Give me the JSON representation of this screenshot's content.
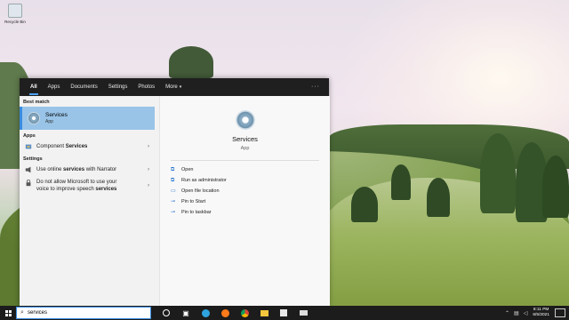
{
  "desktop": {
    "icon_label": "Recycle Bin"
  },
  "start_menu": {
    "tabs": [
      {
        "label": "All",
        "active": true
      },
      {
        "label": "Apps"
      },
      {
        "label": "Documents"
      },
      {
        "label": "Settings"
      },
      {
        "label": "Photos"
      },
      {
        "label": "More"
      }
    ],
    "more_caret": "▾",
    "overflow": "···",
    "best_match": {
      "heading": "Best match",
      "title": "Services",
      "subtitle": "App"
    },
    "apps": {
      "heading": "Apps",
      "items": [
        {
          "prefix": "Component ",
          "bold": "Services",
          "suffix": ""
        }
      ]
    },
    "settings": {
      "heading": "Settings",
      "items": [
        {
          "prefix": "Use online ",
          "bold": "services",
          "suffix": " with Narrator"
        },
        {
          "line1": "Do not allow Microsoft to use your",
          "line2_prefix": "voice to improve speech ",
          "line2_bold": "services"
        }
      ]
    },
    "preview": {
      "title": "Services",
      "subtitle": "App",
      "actions": [
        {
          "icon": "open-icon",
          "label": "Open"
        },
        {
          "icon": "run-as-admin-icon",
          "label": "Run as administrator"
        },
        {
          "icon": "folder-icon",
          "label": "Open file location"
        },
        {
          "icon": "pin-icon",
          "label": "Pin to Start"
        },
        {
          "icon": "pin-icon",
          "label": "Pin to taskbar"
        }
      ]
    }
  },
  "taskbar": {
    "search_value": "services",
    "time": "8:11 PM",
    "date": "6/5/2021"
  },
  "colors": {
    "accent": "#3a8de0",
    "selection": "#99c4e8",
    "menu_header": "#1f1f1f",
    "taskbar": "#1c1c1c"
  }
}
